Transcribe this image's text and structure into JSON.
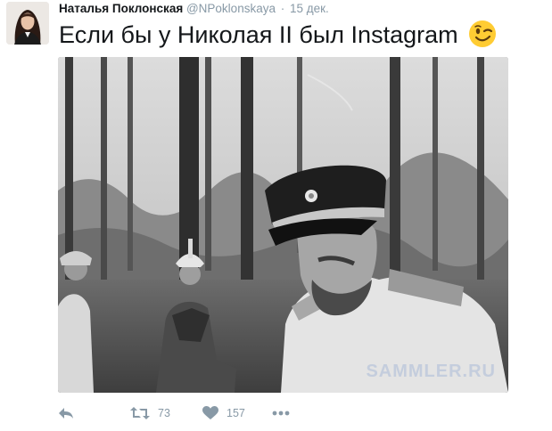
{
  "author": {
    "name": "Наталья Поклонская",
    "handle": "@NPoklonskaya",
    "separator": "·",
    "time": "15 дек."
  },
  "tweet": {
    "text": "Если бы у Николая II был Instagram",
    "emoji": "winking-face"
  },
  "media": {
    "watermark": "SAMMLER.RU"
  },
  "actions": {
    "reply_icon": "reply-icon",
    "retweet_icon": "retweet-icon",
    "retweet_count": "73",
    "like_icon": "heart-icon",
    "like_count": "157",
    "more_icon": "more-icon"
  },
  "colors": {
    "action_gray": "#8899a6",
    "text": "#14171a",
    "emoji_yellow": "#ffcc33"
  }
}
